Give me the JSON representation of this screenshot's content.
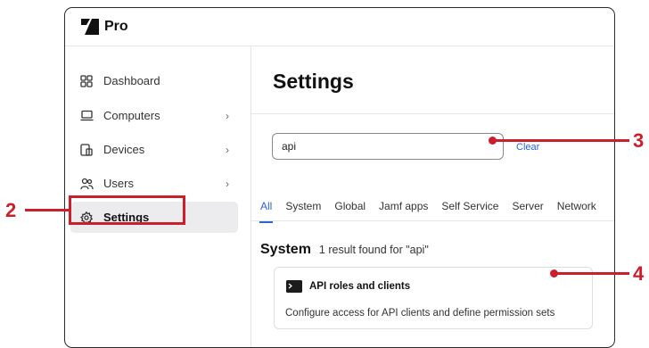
{
  "app": {
    "name": "Pro"
  },
  "sidebar": {
    "items": [
      {
        "label": "Dashboard",
        "icon": "dashboard-icon",
        "chevron": ""
      },
      {
        "label": "Computers",
        "icon": "laptop-icon",
        "chevron": "›"
      },
      {
        "label": "Devices",
        "icon": "devices-icon",
        "chevron": "›"
      },
      {
        "label": "Users",
        "icon": "users-icon",
        "chevron": "›"
      },
      {
        "label": "Settings",
        "icon": "gear-icon",
        "chevron": ""
      }
    ],
    "active": "Settings"
  },
  "main": {
    "title": "Settings",
    "search": {
      "value": "api",
      "clear_label": "Clear"
    },
    "tabs": [
      "All",
      "System",
      "Global",
      "Jamf apps",
      "Self Service",
      "Server",
      "Network"
    ],
    "active_tab": "All",
    "section": {
      "title": "System",
      "result_text": "1 result found for \"api\""
    },
    "result_card": {
      "icon": "terminal-icon",
      "title": "API roles and clients",
      "description": "Configure access for API clients and define permission sets"
    }
  },
  "annotations": {
    "callouts": [
      "2",
      "3",
      "4"
    ],
    "color": "#cc1f2b"
  },
  "colors": {
    "accent": "#2a66d9",
    "active_bg": "#ececee"
  }
}
